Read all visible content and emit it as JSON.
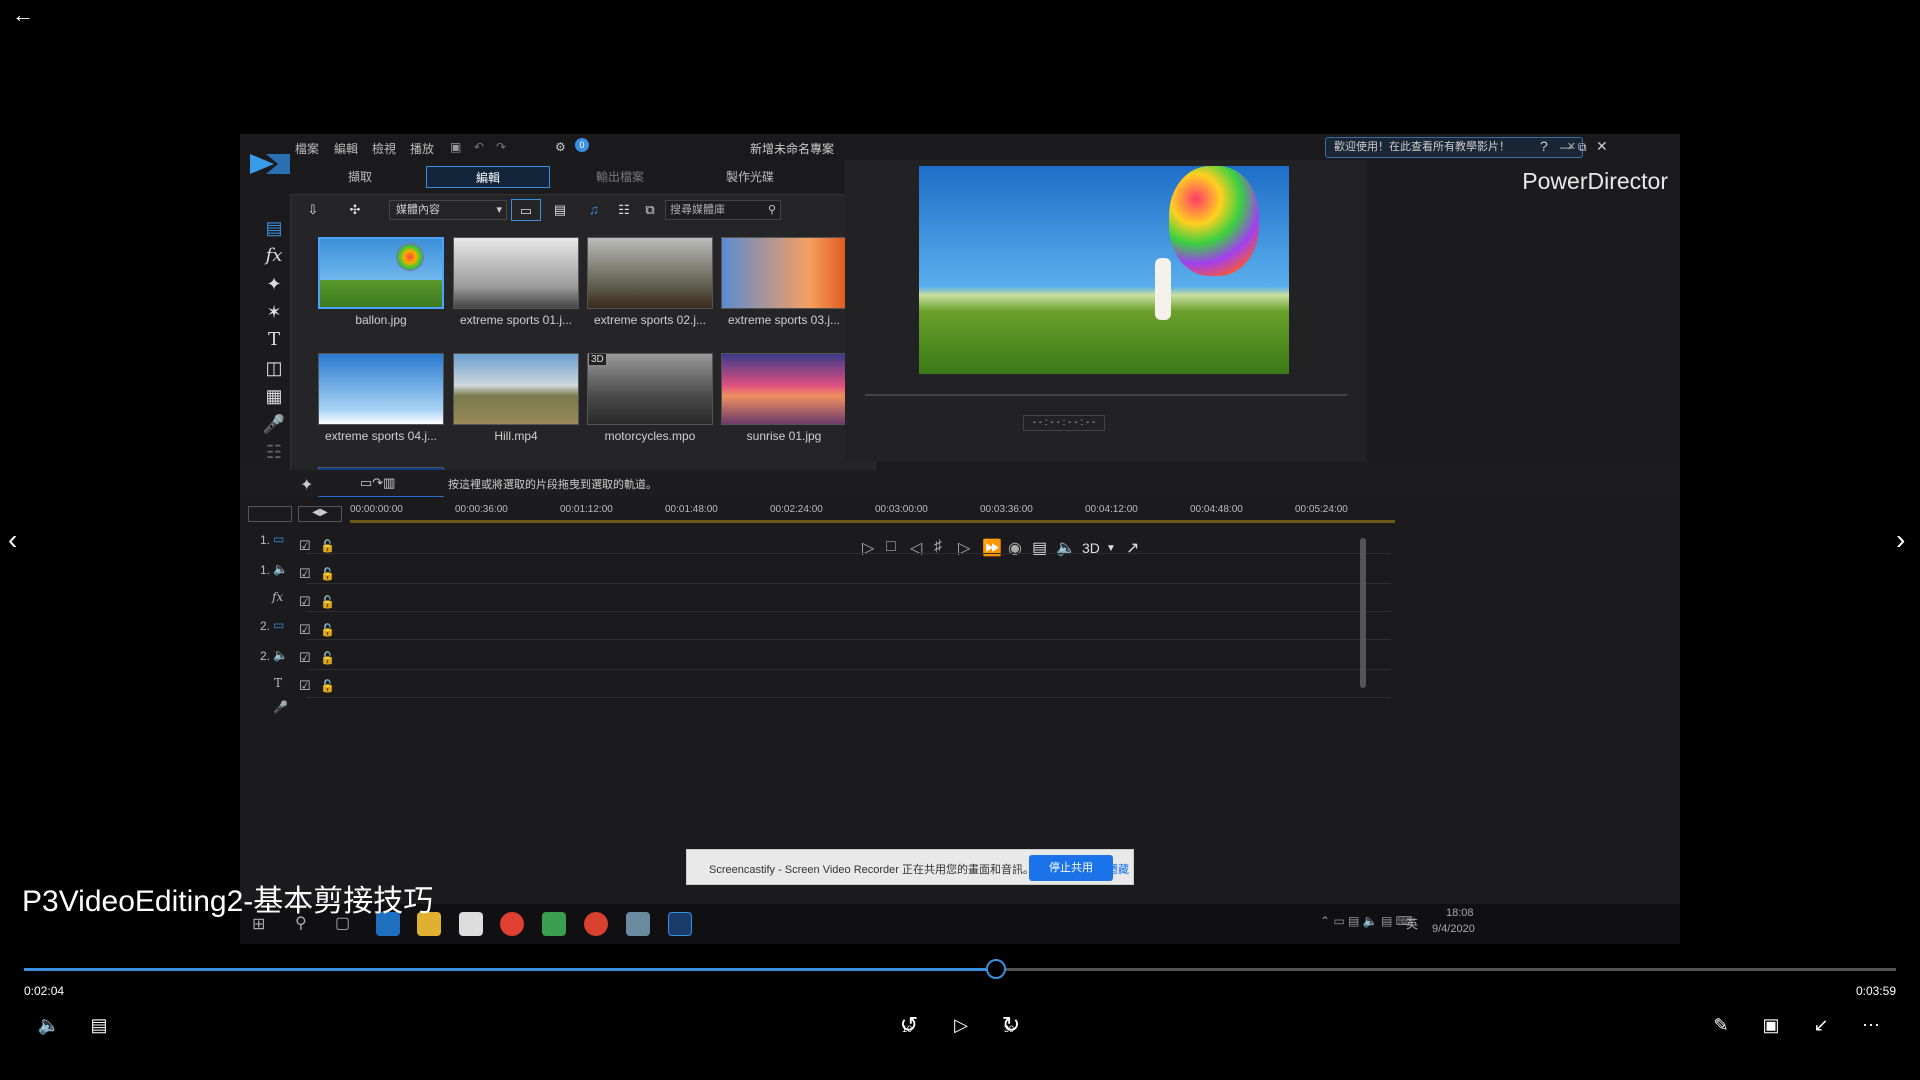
{
  "player": {
    "title": "P3VideoEditing2-基本剪接技巧",
    "current_time": "0:02:04",
    "total_time": "0:03:59",
    "progress": 0.519,
    "skip_back_label": "10",
    "skip_forward_label": "30"
  },
  "app": {
    "menus": [
      "檔案",
      "編輯",
      "檢視",
      "播放"
    ],
    "project_title": "新增未命名專案",
    "notice": "歡迎使用！在此查看所有教學影片！",
    "brand": "PowerDirector",
    "tabs": [
      "擷取",
      "編輯",
      "輸出檔案",
      "製作光碟"
    ],
    "library_dropdown": "媒體內容",
    "search_placeholder": "搜尋媒體庫",
    "media": [
      {
        "name": "ballon.jpg"
      },
      {
        "name": "extreme sports 01.j..."
      },
      {
        "name": "extreme sports 02.j..."
      },
      {
        "name": "extreme sports 03.j..."
      },
      {
        "name": "extreme sports 04.j..."
      },
      {
        "name": "Hill.mp4"
      },
      {
        "name": "motorcycles.mpo",
        "badge": "3D"
      },
      {
        "name": "sunrise 01.jpg"
      }
    ],
    "preview_timecode": "- - : - - : - - : - -",
    "preview_3d": "3D",
    "timeline_hint": "按這裡或將選取的片段拖曳到選取的軌道。",
    "ruler": [
      "00:00:00:00",
      "00:00:36:00",
      "00:01:12:00",
      "00:01:48:00",
      "00:02:24:00",
      "00:03:00:00",
      "00:03:36:00",
      "00:04:12:00",
      "00:04:48:00",
      "00:05:24:00"
    ],
    "tracks": [
      "1.",
      "1.",
      "fx",
      "2.",
      "2.",
      "T",
      ""
    ],
    "share_bar": {
      "text": "Screencastify - Screen Video Recorder 正在共用您的畫面和音訊。",
      "stop": "停止共用",
      "hide": "隱藏"
    },
    "clock_time": "18:08",
    "clock_date": "9/4/2020",
    "ime": "英"
  }
}
